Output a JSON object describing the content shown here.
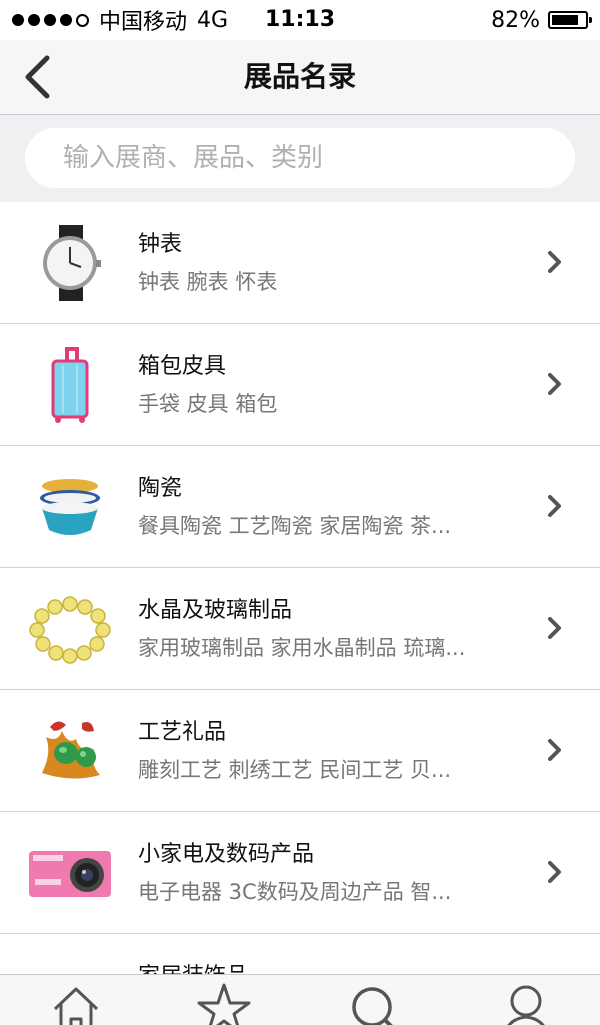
{
  "status": {
    "carrier": "中国移动",
    "network": "4G",
    "time": "11:13",
    "battery": "82%",
    "battery_level": 0.82
  },
  "nav": {
    "title": "展品名录",
    "back_icon": "chevron-left-icon"
  },
  "search": {
    "placeholder": "输入展商、展品、类别",
    "value": ""
  },
  "items": [
    {
      "title": "钟表",
      "subtitle": "钟表 腕表 怀表",
      "icon": "watch-icon"
    },
    {
      "title": "箱包皮具",
      "subtitle": "手袋 皮具 箱包",
      "icon": "luggage-icon"
    },
    {
      "title": "陶瓷",
      "subtitle": "餐具陶瓷 工艺陶瓷 家居陶瓷 茶...",
      "icon": "ceramic-bowls-icon"
    },
    {
      "title": "水晶及玻璃制品",
      "subtitle": "家用玻璃制品 家用水晶制品 琉璃...",
      "icon": "crystal-bracelet-icon"
    },
    {
      "title": "工艺礼品",
      "subtitle": "雕刻工艺 刺绣工艺 民间工艺 贝...",
      "icon": "craft-gift-icon"
    },
    {
      "title": "小家电及数码产品",
      "subtitle": "电子电器 3C数码及周边产品 智...",
      "icon": "camera-icon"
    },
    {
      "title": "家居装饰品",
      "subtitle": "",
      "icon": "home-decor-icon"
    }
  ],
  "tabbar": {
    "icons": [
      "home-icon",
      "star-icon",
      "search-icon",
      "user-icon"
    ]
  },
  "colors": {
    "accent": "#555555",
    "divider": "#cfcfd4",
    "subtitle": "#777777"
  }
}
